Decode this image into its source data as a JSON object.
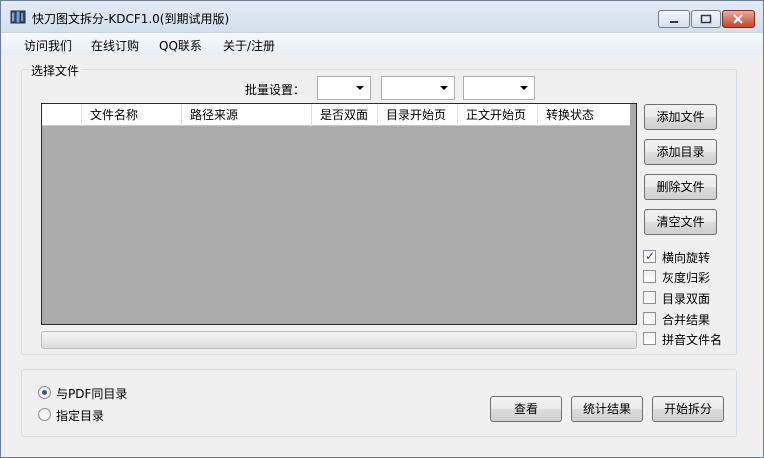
{
  "window": {
    "title": "快刀图文拆分-KDCF1.0(到期试用版)",
    "controls": [
      "minimize",
      "maximize",
      "close"
    ]
  },
  "menu": {
    "items": [
      "访问我们",
      "在线订购",
      "QQ联系",
      "关于/注册"
    ]
  },
  "file_group": {
    "label": "选择文件",
    "batch_label": "批量设置：",
    "combos": [
      "",
      "",
      ""
    ]
  },
  "grid": {
    "columns": [
      "",
      "文件名称",
      "路径来源",
      "是否双面",
      "目录开始页",
      "正文开始页",
      "转换状态"
    ],
    "rows": []
  },
  "side_buttons": {
    "add_file": "添加文件",
    "add_dir": "添加目录",
    "delete_file": "删除文件",
    "clear_files": "清空文件"
  },
  "options": [
    {
      "label": "横向旋转",
      "checked": true
    },
    {
      "label": "灰度归彩",
      "checked": false
    },
    {
      "label": "目录双面",
      "checked": false
    },
    {
      "label": "合并结果",
      "checked": false
    },
    {
      "label": "拼音文件名",
      "checked": false
    }
  ],
  "output": {
    "same_dir": "与PDF同目录",
    "custom_dir": "指定目录",
    "selected": "same_dir"
  },
  "bottom_buttons": {
    "view": "查看",
    "stats": "统计结果",
    "start": "开始拆分"
  },
  "colors": {
    "grid_background": "#ababab",
    "titlebar": "#dbe5f1"
  }
}
